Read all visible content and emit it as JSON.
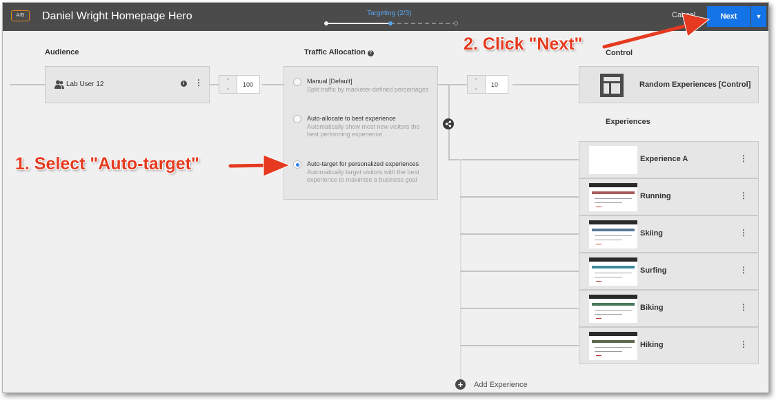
{
  "header": {
    "badge": "A/B",
    "title": "Daniel Wright Homepage Hero",
    "step_label": "Targeting (2/3)",
    "step_current": 2,
    "step_total": 3,
    "cancel_label": "Cancel",
    "next_label": "Next"
  },
  "audience": {
    "section_label": "Audience",
    "name": "Lab User 12",
    "allocation": "100"
  },
  "traffic": {
    "section_label": "Traffic Allocation",
    "options": [
      {
        "title": "Manual [Default]",
        "desc": "Split traffic by marketer-defined percentages",
        "selected": false
      },
      {
        "title": "Auto-allocate to best experience",
        "desc": "Automatically show most new visitors the best performing experience",
        "selected": false
      },
      {
        "title": "Auto-target for personalized experiences",
        "desc": "Automatically target visitors with the best experience to maximize a business goal",
        "selected": true
      }
    ],
    "control_allocation": "10"
  },
  "control": {
    "section_label": "Control",
    "name": "Random Experiences [Control]"
  },
  "experiences": {
    "section_label": "Experiences",
    "items": [
      {
        "name": "Experience A"
      },
      {
        "name": "Running"
      },
      {
        "name": "Skiing"
      },
      {
        "name": "Surfing"
      },
      {
        "name": "Biking"
      },
      {
        "name": "Hiking"
      }
    ],
    "add_label": "Add Experience"
  },
  "annotations": {
    "step1": "1. Select \"Auto-target\"",
    "step2": "2. Click \"Next\""
  },
  "colors": {
    "accent": "#1473e6",
    "annotation": "#e53a1f",
    "badge_border": "#e68619",
    "topbar": "#4b4b4b"
  }
}
